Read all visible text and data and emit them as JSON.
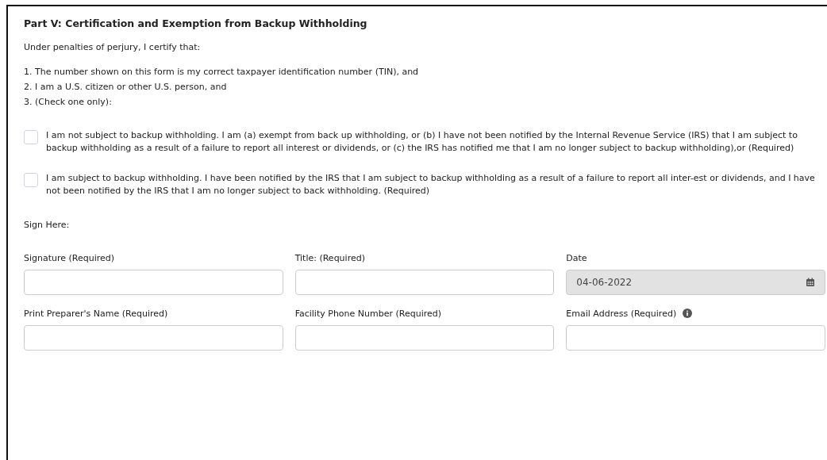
{
  "section": {
    "title": "Part V: Certification and Exemption from Backup Withholding",
    "intro": "Under penalties of perjury, I certify that:",
    "statements": [
      "1. The number shown on this form is my correct taxpayer identification number (TIN), and",
      "2. I am a U.S. citizen or other U.S. person, and",
      "3. (Check one only):"
    ],
    "options": [
      {
        "label": "I am not subject to backup withholding. I am (a) exempt from back up withholding, or (b) I have not been notified by the Internal Revenue Service (IRS) that I am subject to backup withholding as a result of a failure to report all interest or dividends, or (c) the IRS has notified me that I am no longer subject to backup withholding),or (Required)",
        "checked": false
      },
      {
        "label": "I am subject to backup withholding. I have been notified by the IRS that I am subject to backup withholding as a result of a failure to report all inter-est or dividends, and I have not been notified by the IRS that I am no longer subject to back withholding. (Required)",
        "checked": false
      }
    ],
    "sign_label": "Sign Here:",
    "fields": [
      {
        "label": "Signature (Required)",
        "kind": "text",
        "disabled": false
      },
      {
        "label": "Title: (Required)",
        "kind": "text",
        "disabled": false
      },
      {
        "label": "Date",
        "kind": "date",
        "value": "04-06-2022",
        "disabled": true
      },
      {
        "label": "Print Preparer's Name (Required)",
        "kind": "text",
        "disabled": false
      },
      {
        "label": "Facility Phone Number (Required)",
        "kind": "text",
        "disabled": false
      },
      {
        "label": "Email Address (Required)",
        "kind": "text",
        "disabled": false,
        "info": true
      }
    ]
  }
}
